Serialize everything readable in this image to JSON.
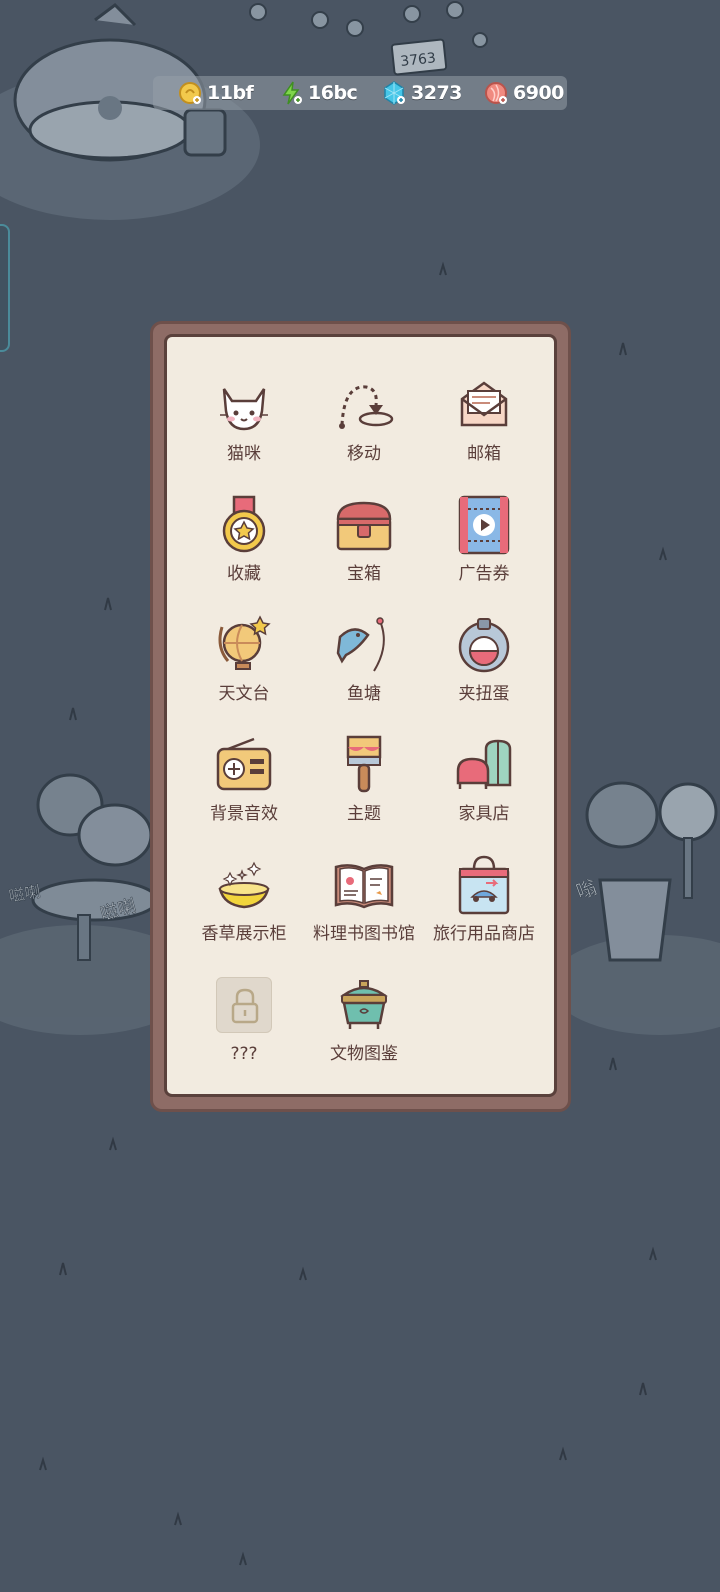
{
  "resources": {
    "coin": {
      "value": "11bf",
      "icon": "coin-icon",
      "color": "#f2c94c"
    },
    "energy": {
      "value": "16bc",
      "icon": "lightning-icon",
      "color": "#7fd64b"
    },
    "gem": {
      "value": "3273",
      "icon": "gem-icon",
      "color": "#46c6e8"
    },
    "shell": {
      "value": "6900",
      "icon": "shell-icon",
      "color": "#f08a80"
    }
  },
  "scene": {
    "signpost_number": "3763",
    "sound_effects": [
      "嗞喇",
      "嗞喇",
      "嗡"
    ]
  },
  "menu": {
    "items": [
      {
        "label": "猫咪",
        "icon": "cat-icon"
      },
      {
        "label": "移动",
        "icon": "move-arrow-icon"
      },
      {
        "label": "邮箱",
        "icon": "mail-envelope-icon"
      },
      {
        "label": "收藏",
        "icon": "medal-icon"
      },
      {
        "label": "宝箱",
        "icon": "treasure-chest-icon"
      },
      {
        "label": "广告券",
        "icon": "ad-ticket-icon"
      },
      {
        "label": "天文台",
        "icon": "globe-star-icon"
      },
      {
        "label": "鱼塘",
        "icon": "fish-hook-icon"
      },
      {
        "label": "夹扭蛋",
        "icon": "claw-capsule-icon"
      },
      {
        "label": "背景音效",
        "icon": "radio-icon"
      },
      {
        "label": "主题",
        "icon": "paintbrush-icon"
      },
      {
        "label": "家具店",
        "icon": "sofa-door-icon"
      },
      {
        "label": "香草展示柜",
        "icon": "golden-bowl-icon"
      },
      {
        "label": "料理书图书馆",
        "icon": "open-cookbook-icon"
      },
      {
        "label": "旅行用品商店",
        "icon": "shopping-bag-icon"
      },
      {
        "label": "???",
        "icon": "lock-icon"
      },
      {
        "label": "文物图鉴",
        "icon": "antique-pot-icon"
      }
    ]
  }
}
